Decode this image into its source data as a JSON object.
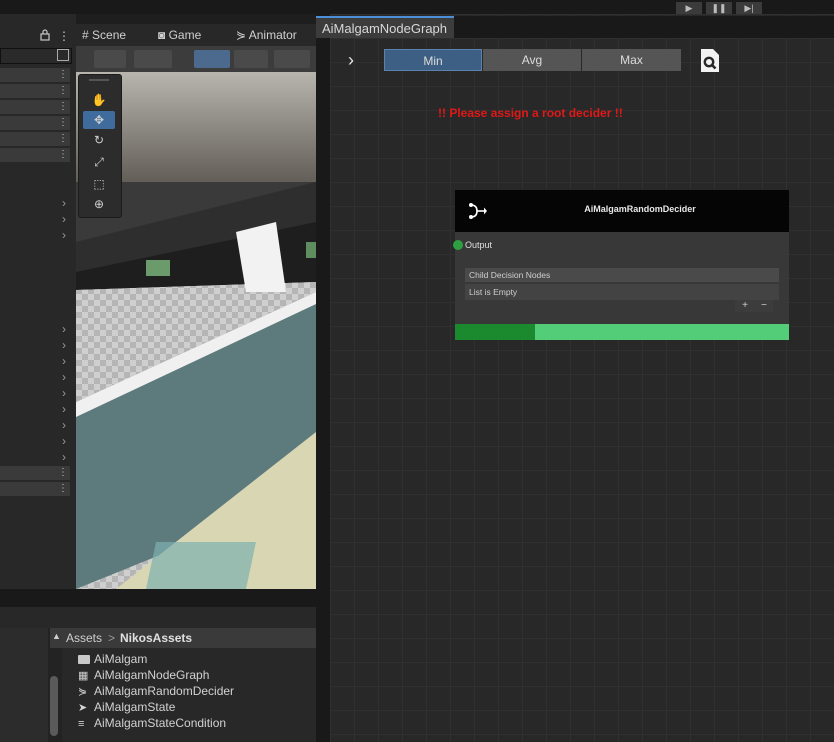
{
  "top_bar": {
    "play_controls": [
      "▶",
      "❚❚",
      "▶|"
    ]
  },
  "left_panel": {
    "lock_icon": "lock-icon",
    "kebab_glyph": "⋮"
  },
  "scene_tabs": [
    {
      "label": "Scene",
      "icon": "#"
    },
    {
      "label": "Game",
      "icon": "◙"
    },
    {
      "label": "Animator",
      "icon": "⋟"
    }
  ],
  "graph": {
    "tab_title": "AiMalgamNodeGraph",
    "segments": [
      "Min",
      "Avg",
      "Max"
    ],
    "selected_segment": "Min",
    "warning": "!! Please assign a root decider !!",
    "node": {
      "title": "AiMalgamRandomDecider",
      "output_label": "Output",
      "list_header": "Child Decision Nodes",
      "list_empty": "List is Empty",
      "add_symbol": "+",
      "remove_symbol": "−"
    }
  },
  "project": {
    "breadcrumb": [
      "Assets",
      "NikosAssets"
    ],
    "separator": ">",
    "assets": [
      {
        "name": "AiMalgam",
        "icon": "folder-icon"
      },
      {
        "name": "AiMalgamNodeGraph",
        "icon": "graph-icon"
      },
      {
        "name": "AiMalgamRandomDecider",
        "icon": "decider-icon"
      },
      {
        "name": "AiMalgamState",
        "icon": "state-icon"
      },
      {
        "name": "AiMalgamStateCondition",
        "icon": "condition-icon"
      }
    ]
  },
  "colors": {
    "accent": "#4a8fd8",
    "warning": "#e01818",
    "progress_dark": "#1b8a2e",
    "progress_light": "#54cd79",
    "output_port": "#2ea043"
  }
}
